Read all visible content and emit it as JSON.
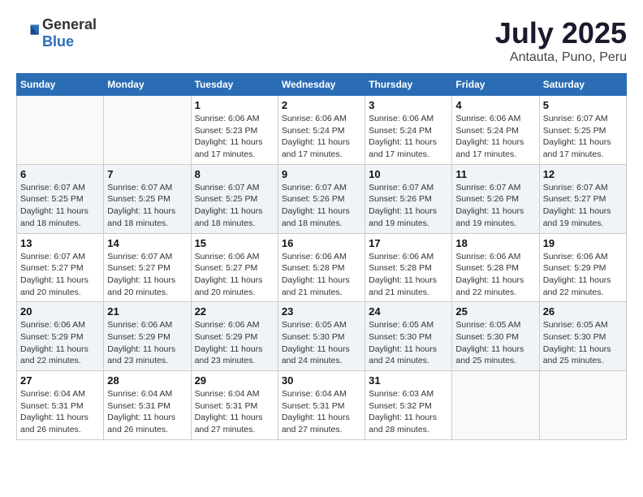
{
  "header": {
    "logo_general": "General",
    "logo_blue": "Blue",
    "month_year": "July 2025",
    "location": "Antauta, Puno, Peru"
  },
  "weekdays": [
    "Sunday",
    "Monday",
    "Tuesday",
    "Wednesday",
    "Thursday",
    "Friday",
    "Saturday"
  ],
  "weeks": [
    [
      {
        "day": "",
        "empty": true
      },
      {
        "day": "",
        "empty": true
      },
      {
        "day": "1",
        "sunrise": "6:06 AM",
        "sunset": "5:23 PM",
        "daylight": "11 hours and 17 minutes."
      },
      {
        "day": "2",
        "sunrise": "6:06 AM",
        "sunset": "5:24 PM",
        "daylight": "11 hours and 17 minutes."
      },
      {
        "day": "3",
        "sunrise": "6:06 AM",
        "sunset": "5:24 PM",
        "daylight": "11 hours and 17 minutes."
      },
      {
        "day": "4",
        "sunrise": "6:06 AM",
        "sunset": "5:24 PM",
        "daylight": "11 hours and 17 minutes."
      },
      {
        "day": "5",
        "sunrise": "6:07 AM",
        "sunset": "5:25 PM",
        "daylight": "11 hours and 17 minutes."
      }
    ],
    [
      {
        "day": "6",
        "sunrise": "6:07 AM",
        "sunset": "5:25 PM",
        "daylight": "11 hours and 18 minutes."
      },
      {
        "day": "7",
        "sunrise": "6:07 AM",
        "sunset": "5:25 PM",
        "daylight": "11 hours and 18 minutes."
      },
      {
        "day": "8",
        "sunrise": "6:07 AM",
        "sunset": "5:25 PM",
        "daylight": "11 hours and 18 minutes."
      },
      {
        "day": "9",
        "sunrise": "6:07 AM",
        "sunset": "5:26 PM",
        "daylight": "11 hours and 18 minutes."
      },
      {
        "day": "10",
        "sunrise": "6:07 AM",
        "sunset": "5:26 PM",
        "daylight": "11 hours and 19 minutes."
      },
      {
        "day": "11",
        "sunrise": "6:07 AM",
        "sunset": "5:26 PM",
        "daylight": "11 hours and 19 minutes."
      },
      {
        "day": "12",
        "sunrise": "6:07 AM",
        "sunset": "5:27 PM",
        "daylight": "11 hours and 19 minutes."
      }
    ],
    [
      {
        "day": "13",
        "sunrise": "6:07 AM",
        "sunset": "5:27 PM",
        "daylight": "11 hours and 20 minutes."
      },
      {
        "day": "14",
        "sunrise": "6:07 AM",
        "sunset": "5:27 PM",
        "daylight": "11 hours and 20 minutes."
      },
      {
        "day": "15",
        "sunrise": "6:06 AM",
        "sunset": "5:27 PM",
        "daylight": "11 hours and 20 minutes."
      },
      {
        "day": "16",
        "sunrise": "6:06 AM",
        "sunset": "5:28 PM",
        "daylight": "11 hours and 21 minutes."
      },
      {
        "day": "17",
        "sunrise": "6:06 AM",
        "sunset": "5:28 PM",
        "daylight": "11 hours and 21 minutes."
      },
      {
        "day": "18",
        "sunrise": "6:06 AM",
        "sunset": "5:28 PM",
        "daylight": "11 hours and 22 minutes."
      },
      {
        "day": "19",
        "sunrise": "6:06 AM",
        "sunset": "5:29 PM",
        "daylight": "11 hours and 22 minutes."
      }
    ],
    [
      {
        "day": "20",
        "sunrise": "6:06 AM",
        "sunset": "5:29 PM",
        "daylight": "11 hours and 22 minutes."
      },
      {
        "day": "21",
        "sunrise": "6:06 AM",
        "sunset": "5:29 PM",
        "daylight": "11 hours and 23 minutes."
      },
      {
        "day": "22",
        "sunrise": "6:06 AM",
        "sunset": "5:29 PM",
        "daylight": "11 hours and 23 minutes."
      },
      {
        "day": "23",
        "sunrise": "6:05 AM",
        "sunset": "5:30 PM",
        "daylight": "11 hours and 24 minutes."
      },
      {
        "day": "24",
        "sunrise": "6:05 AM",
        "sunset": "5:30 PM",
        "daylight": "11 hours and 24 minutes."
      },
      {
        "day": "25",
        "sunrise": "6:05 AM",
        "sunset": "5:30 PM",
        "daylight": "11 hours and 25 minutes."
      },
      {
        "day": "26",
        "sunrise": "6:05 AM",
        "sunset": "5:30 PM",
        "daylight": "11 hours and 25 minutes."
      }
    ],
    [
      {
        "day": "27",
        "sunrise": "6:04 AM",
        "sunset": "5:31 PM",
        "daylight": "11 hours and 26 minutes."
      },
      {
        "day": "28",
        "sunrise": "6:04 AM",
        "sunset": "5:31 PM",
        "daylight": "11 hours and 26 minutes."
      },
      {
        "day": "29",
        "sunrise": "6:04 AM",
        "sunset": "5:31 PM",
        "daylight": "11 hours and 27 minutes."
      },
      {
        "day": "30",
        "sunrise": "6:04 AM",
        "sunset": "5:31 PM",
        "daylight": "11 hours and 27 minutes."
      },
      {
        "day": "31",
        "sunrise": "6:03 AM",
        "sunset": "5:32 PM",
        "daylight": "11 hours and 28 minutes."
      },
      {
        "day": "",
        "empty": true
      },
      {
        "day": "",
        "empty": true
      }
    ]
  ],
  "labels": {
    "sunrise": "Sunrise:",
    "sunset": "Sunset:",
    "daylight": "Daylight:"
  }
}
